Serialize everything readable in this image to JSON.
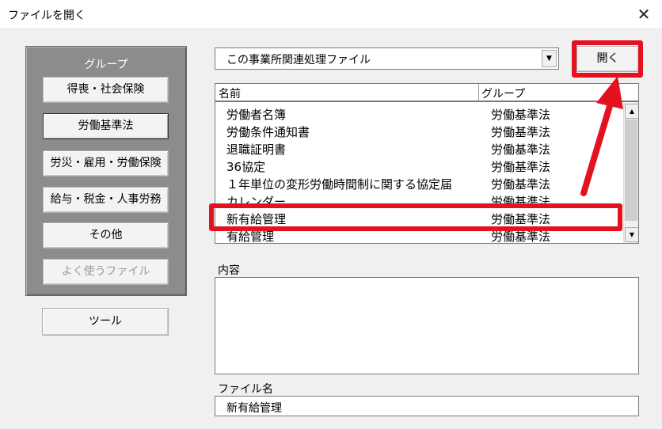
{
  "window": {
    "title": "ファイルを開く",
    "close_icon": "close-icon",
    "close_symbol": "✕"
  },
  "group_panel": {
    "heading": "グループ",
    "buttons": [
      {
        "label": "得喪・社会保険",
        "selected": false,
        "enabled": true
      },
      {
        "label": "労働基準法",
        "selected": true,
        "enabled": true
      },
      {
        "label": "労災・雇用・労働保険",
        "selected": false,
        "enabled": true
      },
      {
        "label": "給与・税金・人事労務",
        "selected": false,
        "enabled": true
      },
      {
        "label": "その他",
        "selected": false,
        "enabled": true
      },
      {
        "label": "よく使うファイル",
        "selected": false,
        "enabled": false
      }
    ]
  },
  "tool_button": "ツール",
  "file_filter": {
    "selected": "この事業所関連処理ファイル",
    "dropdown_icon": "chevron-down-icon"
  },
  "open_button": "開く",
  "file_list": {
    "columns": [
      "名前",
      "グループ"
    ],
    "rows": [
      {
        "name": "労働者名簿",
        "group": "労働基準法"
      },
      {
        "name": "労働条件通知書",
        "group": "労働基準法"
      },
      {
        "name": "退職証明書",
        "group": "労働基準法"
      },
      {
        "name": "36協定",
        "group": "労働基準法"
      },
      {
        "name": "１年単位の変形労働時間制に関する協定届",
        "group": "労働基準法"
      },
      {
        "name": "カレンダー",
        "group": "労働基準法"
      },
      {
        "name": "新有給管理",
        "group": "労働基準法"
      },
      {
        "name": "有給管理",
        "group": "労働基準法"
      }
    ],
    "selected_index": 6
  },
  "details": {
    "content_label": "内容",
    "content_value": "",
    "filename_label": "ファイル名",
    "filename_value": "新有給管理"
  },
  "colors": {
    "annotation_red": "#e2131f",
    "panel_gray": "#8c8c8c",
    "window_bg": "#f0f0f0"
  }
}
